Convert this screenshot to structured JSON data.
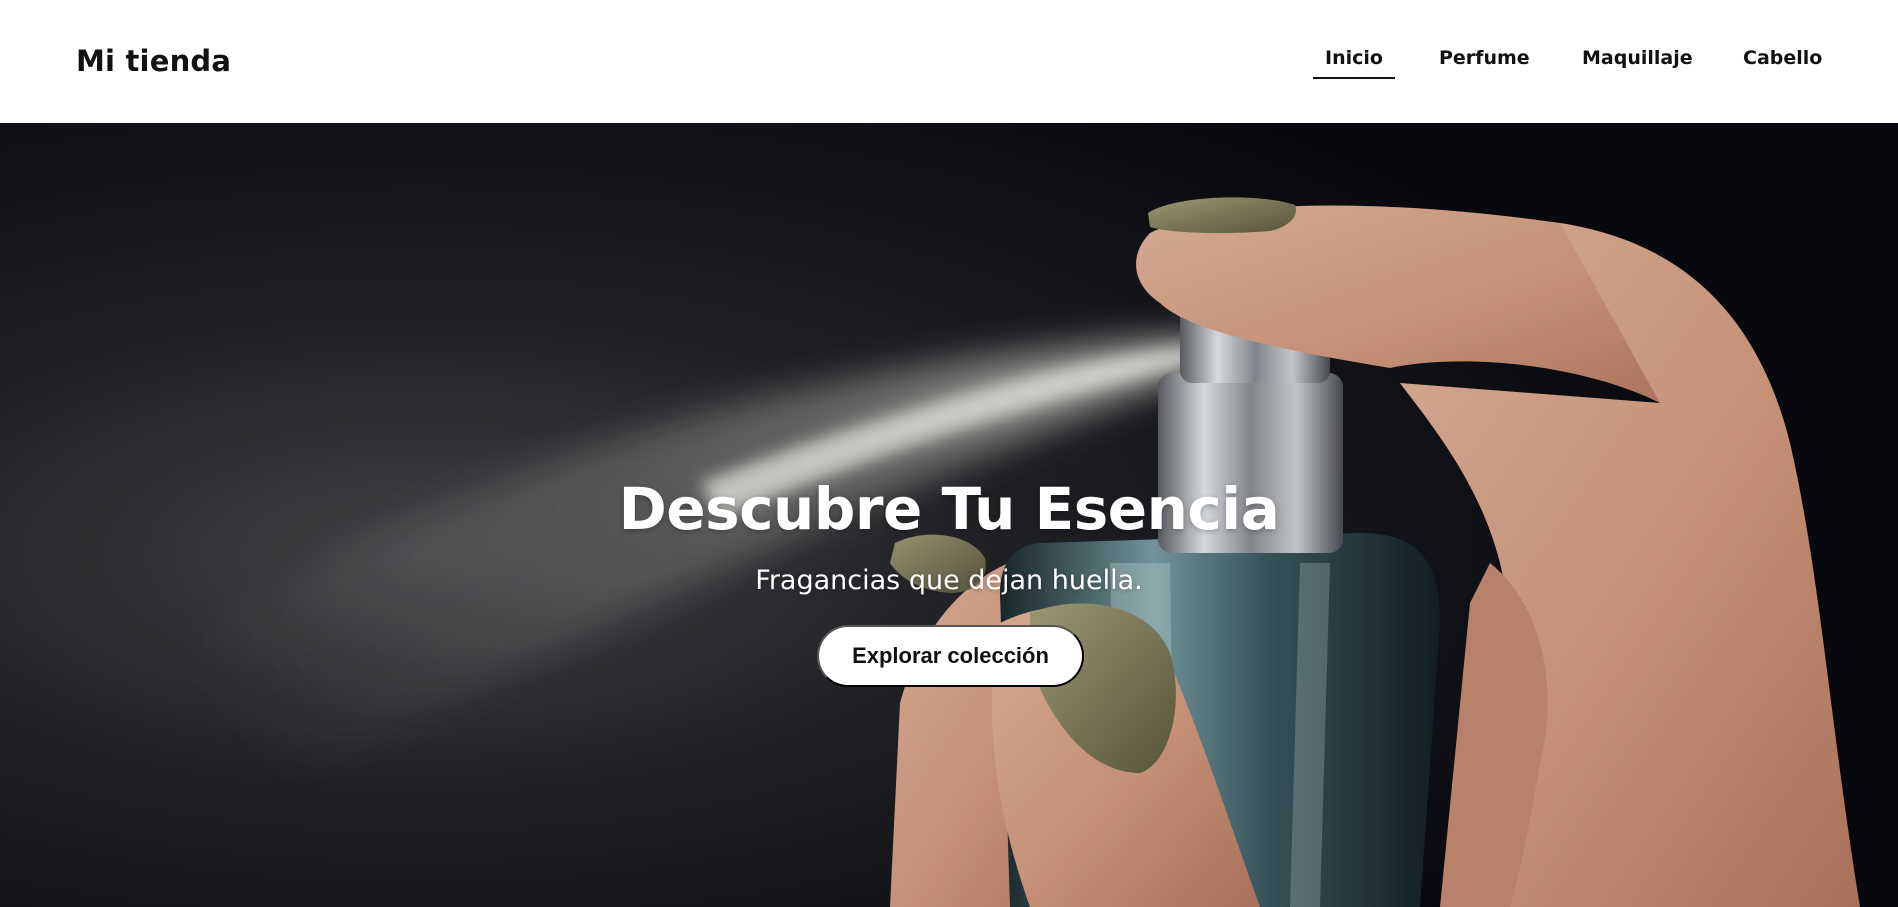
{
  "header": {
    "brand": "Mi tienda",
    "nav": [
      {
        "label": "Inicio",
        "active": true
      },
      {
        "label": "Perfume",
        "active": false
      },
      {
        "label": "Maquillaje",
        "active": false
      },
      {
        "label": "Cabello",
        "active": false
      }
    ]
  },
  "hero": {
    "title": "Descubre Tu Esencia",
    "subtitle": "Fragancias que dejan huella.",
    "cta_label": "Explorar colección"
  },
  "colors": {
    "header_bg": "#ffffff",
    "text_dark": "#111111",
    "hero_bg": "#0f1016",
    "button_bg": "#ffffff",
    "nail_color": "#7d7a55",
    "skin_tone": "#d9a58c"
  }
}
